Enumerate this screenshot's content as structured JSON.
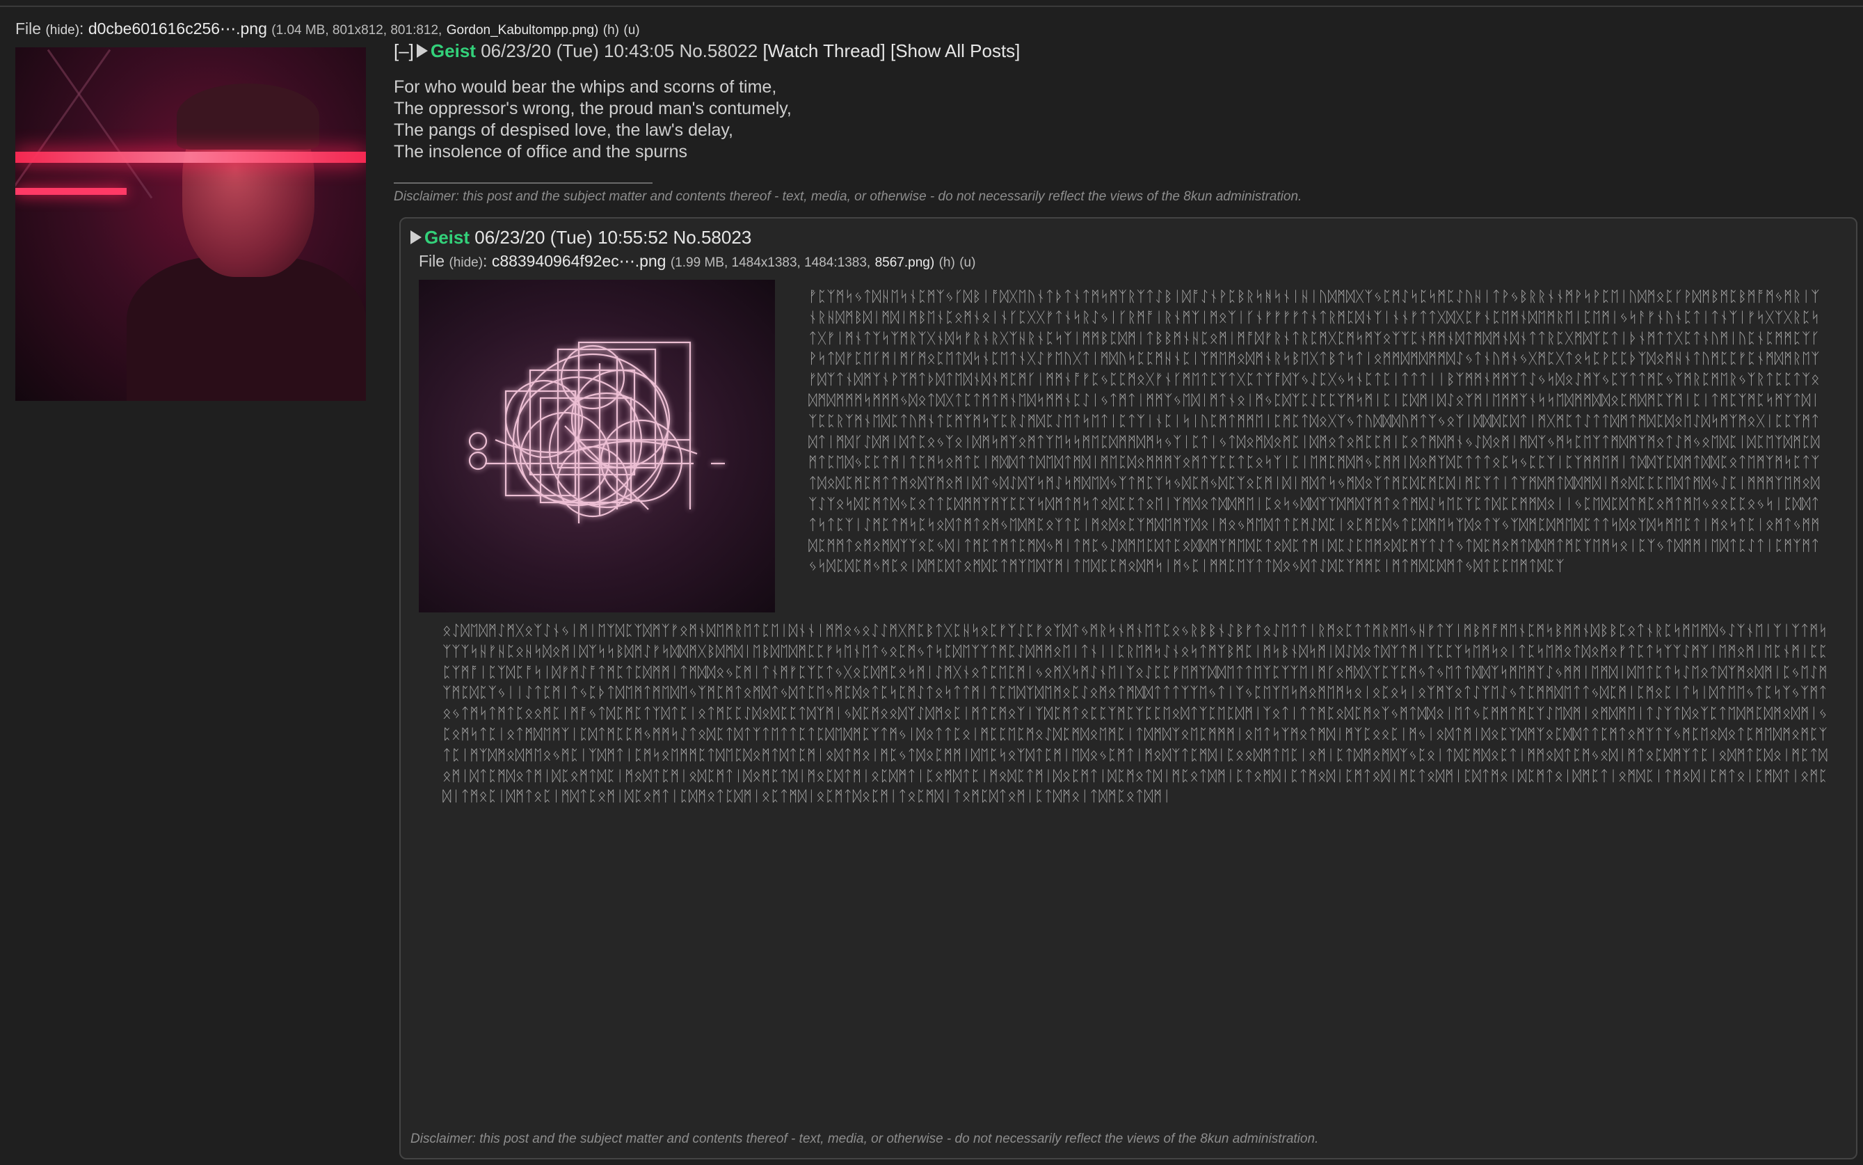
{
  "op": {
    "file": {
      "label": "File",
      "hide": "(hide)",
      "colon": ":",
      "filename": "d0cbe601616c256⋯.png",
      "info": "(1.04 MB, 801x812, 801:812,",
      "orig_name": "Gordon_Kabultompp.png)",
      "h": "(h)",
      "u": "(u)"
    },
    "header": {
      "collapse": "[–]",
      "name": "Geist",
      "datetime": "06/23/20 (Tue) 10:43:05",
      "number": "No.58022",
      "watch": "[Watch Thread]",
      "show_all": "[Show All Posts]"
    },
    "body": [
      "For who would bear the whips and scorns of time,",
      "The oppressor's wrong, the proud man's contumely,",
      "The pangs of despised love, the law's delay,",
      "The insolence of office and the spurns"
    ],
    "disclaimer": "Disclaimer: this post and the subject matter and contents thereof - text, media, or otherwise - do not necessarily reflect the views of the 8kun administration."
  },
  "reply": {
    "header": {
      "name": "Geist",
      "datetime": "06/23/20 (Tue) 10:55:52",
      "number": "No.58023"
    },
    "file": {
      "label": "File",
      "hide": "(hide)",
      "colon": ":",
      "filename": "c883940964f92ec⋯.png",
      "info": "(1.99 MB, 1484x1383, 1484:1383,",
      "size_png": "8567.png)",
      "h": "(h)",
      "u": "(u)"
    },
    "runes_top": "ᚡᛈᛉᛗᛋᛃᛏᛞᚺᛖᛋᚾᛈᛗᛉᛃᚴᛞᛒᛁᚩᛞᚷᛖᚢᚾᛏᚦᛏᚾᛏᛗᛋᛗᛉᚱᛉᛏᛇᛒᛁᛞᚩᛇᚾᚹᛈᛒᚱᛋᚻᛋᚾᛁᚺᛁᚢᛞᛗᛞᚷᛉᛃᛈᛗᛇᛋᛈᛋᛗᛈᛇᚢᚺᛁᛏᚹᛃᛒᚱᚱᚾᚾᛗᚹᛋᚹᛈᛖᛁᚢᛞᛗᛟᛈᚴᚹᛞᛗᛒᛗᛈᛒᛗᚩᛗᛃᛗᚱᛁᛉᚾᚱᚺᛞᛗᛒᛞᛁᛗᛞᛁᛗᛒᛖᚾᛈᛟᛗᚾᛟᛁᚾᚴᛈᚷᚷᚠᛏᚾᛋᚱᛇᛃᛁᚴᚱᛗᚩᛁᚱᚾᛗᛉᛁᛗᛟᛉᛁᚴᚾᚠᚠᚠᚠᛏᚾᛏᚱᛗᛈᛞᚾᛉᛁᚾᚾᚠᛏᛏᚷᛞᚷᛈᚠᚾᛈᛖᛗᚾᛞᛖᛗᚱᛖᛁᛈᛖᛗᛁᛃᛋᚨᚠᚾᚢᚾᛈᛏᛁᛏᚾᛉᛁᚠᛋᚷᛉᚷᚱᛈᛋᛏᚷᚠᛁᛗᚾᛏᛉᛋᛉᛗᚱᛉᚷᚾᛞᛋᚠᚱᚾᚱᚷᛉᚺᚱᚾᛈᛋᛉᛁᛗᛗᛒᛈᛞᛗᛁᛏᛒᛒᛗᚾᚺᛈᛟᛗᛁᛗᚩᛞᚠᚱᚾᛏᚱᛈᛗᚷᛈᛗᛋᛗᛉᛟᛉᛉᛈᚾᛗᛗᚾᛞᛏᛗᛞᛗᚾᛞᚾᛏᛏᚱᛈᚷᛗᛞᛉᛈᛏᛁᚦᚾᛗᛏᛏᚷᛈᛏᚾᚢᛗᛁᚢᛈᚾᛈᛗᛗᛈᛉᚴᚹᛋᛏᛞᚠᛈᛖᚴᛗᛁᛗᚴᛗᛟᛈᛖᛏᛞᛋᚾᛈᛖᛏᚾᚷᛇᚠᛖᚢᚷᛏᛁᛗᛞᚢᛋᛈᛈᛗᚺᚾᛈᛁᛉᛗᛖᛗᛟᛞᛗᚾᚱᛋᛒᛖᚷᛏᛒᛏᛋᛏᛁᛟᛗᛗᛞᛗᛞᛗᛗᛞᛇᛃᛏᚾᚢᛗᚾᛃᚷᛗᛈᚷᛏᛟᛋᛈᚹᛈᛈᚦᛉᛞᛟᛗᚺᚾᛏᚢᛗᛈᛈᚠᛈᚾᛗᛞᛗᚱᛖᛉᚠᛞᛉᛏᚾᛞᛗᛉᚾᚹᛉᛗᛏᚦᛞᛏᛖᛞᚾᛞᚾᛗᛈᛗᚴᛁᛗᛗᚾᚩᚠᛈᛃᛈᛈᛗᛟᚷᚠᚾᚴᛗᛖᛏᛈᛉᛏᚷᛈᛏᛉᚩᛞᛉᛃᛇᛈᚷᛃᛋᚾᛈᛏᛈᛁᛏᛏᛏᛁᛁᛒᛉᛗᛗᚾᛗᛗᛉᛏᛇᛃᛋᛞᛟᛇᛗᛉᛃᛈᛉᛏᛏᛗᛈᛃᛉᛗᚱᛈᛗᛖᚱᛃᛉᚱᛏᛈᛈᛏᛉᛟᛞᛗᛞᛗᛗᛗᛋᛗᛗᛗᛃᛞᛟᛏᛞᚷᛏᛈᛏᛗᛏᛗᚾᛖᛞᛋᛗᛗᚾᛈᛇᛁᛃᛏᛗᛏᛁᛗᛗᛉᛃᛖᛞᛁᛗᛏᚾᛟᛁᛗᛃᛈᛞᛉᛈᛇᛈᛈᛉᛗᛋᛗᛁᛈᛁᛈᛞᛗᛁᛞᛇᛟᛉᛗᛁᛖᛗᛗᛉᚾᛋᛋᛖᛞᛗᛗᛞᛞᛟᛈᛗᛞᛗᛈᛉᛗᛁᛈᛁᛏᛗᛈᛉᛗᛈᛋᛗᛉᛏᛞᛁᛉᛈᛈᚱᛉᛗᚾᛖᛞᛈᛏᚢᛗᚾᛏᛈᛗᛉᛗᛋᛉᛈᚱᛇᛗᛞᛈᛇᛖᛏᛋᛖᛏᛁᛈᛏᛉᛁᚾᛈᛁᛋᛁᚢᛈᛗᛏᛗᛗᛖᛁᛈᛗᛈᛏᛞᛟᚷᛉᛃᛏᚢᛞᛞᛞᚢᛗᛏᛉᛃᛟᛉᛁᛞᛞᛞᛈᛞᛏᛁᛗᚷᛗᛈᛏᛇᛏᛏᛞᛗᛏᛗᛞᛈᛞᛟᛖᛇᛞᛋᛗᛉᛗᛟᚷᛁᛈᛈᛉᛗᛏᛞᛏᛁᛗᛞᚴᛇᛞᛗᛁᛞᛏᛈᛟᛃᛉᛟᛁᛞᛗᛋᛗᛉᛟᛗᛏᛉᛖᛋᛋᛗᛖᛈᛞᛗᛗᛞᛗᛋᛃᛉᛁᛈᛏᛁᛃᛏᛞᛟᛗᛞᛟᛗᛈᛁᛞᛗᛟᛏᛟᛗᛈᛈᛗᛁᛈᛟᛏᛗᛞᛗᚾᛃᛇᛞᛟᛗᛁᛗᛞᛉᛃᛗᛋᛈᛖᛉᛏᛗᛞᛗᛉᛗᛟᛏᛇᛗᛃᛟᛖᛞᛈᛁᛞᛈᛖᛉᛞᛗᛈᛞᛗᛏᛈᛖᛞᛃᛈᛈᛏᛗᛁᛏᛈᛗᛋᛟᛗᛏᛈᛁᛗᛞᛞᛏᛏᛞᛖᛞᛏᛗᛞᛁᛗᛖᛈᛞᛟᛗᛗᛗᛉᛟᛗᛏᛉᛈᛈᛏᛈᛟᛋᛉᛁᛈᛁᛖᛗᛈᛗᛞᛗᛃᛈᛗᛗᛁᛞᛟᛗᛉᛞᛈᛏᛏᛏᛟᛈᛋᛃᛈᛈᛉᛁᛈᛉᛗᛗᛖᛗᛁᛏᛞᛞᛉᛈᛞᛗᛏᛞᛞᛈᛟᛏᛖᛗᛉᛗᛋᛈᛏᛉᛏᛞᛟᛞᛈᛗᛈᛗᛏᛏᛗᛟᛞᛉᛗᛟᛗᛁᛞᛏᛃᛞᛇᛞᛉᛋᛗᛇᛋᛗᛞᛖᛞᛃᛉᛏᛗᛈᛉᛋᛃᛞᛈᛗᛃᛞᛈᛉᛟᛈᛗᛁᛞᛁᛗᛞᛏᛋᛃᛗᛞᛟᛉᛏᛗᛈᛞᛈᛗᛈᛞᛁᛗᛈᛉᛏᛁᛏᛉᛗᛞᛗᛏᛞᛞᛗᛞᛁᛗᛟᛞᛈᛈᛈᛖᛞᛏᛗᛞᛃᛇᛈᛁᛗᛗᛗᛉᛖᛗᛟᛞᛉᛇᛉᛟᛋᛞᛈᛗᛏᛞᛃᛈᛟᛏᛏᛈᛞᛗᛗᛉᛗᛉᛈᛈᛉᛋᛞᛗᛏᛗᛋᛏᛟᛞᛈᛈᛏᛟᛖᛁᛉᛗᛞᛟᛏᛞᛞᛗᛖᛁᛈᛟᛋᛃᛞᛞᛉᛉᛞᛗᛞᛉᛗᛏᛟᛏᛗᛞᛇᛋᛖᛈᛉᛈᛏᛞᛈᛈᛗᛗᛞᛟᛁᛁᛃᛈᛖᛞᛈᛞᛏᛗᛈᛟᛗᛏᛗᛖᛃᛟᛟᛈᛈᛟᛃᛋᛁᛈᛞᛞᛏᛏᛋᛏᛈᛉᛁᛇᛗᛈᛏᛗᛋᛈᛋᛟᛞᛏᛗᛏᛟᛗᛃᛖᛞᛗᛈᛟᛉᛏᛈᛁᛗᛟᛞᛟᛈᛉᛗᛞᛖᛗᛉᛞᛟᛁᛗᛟᛃᛗᛖᛞᛏᛏᛈᛗᛇᛞᛈᛁᛟᛈᛗᛈᛞᛃᛏᛈᛞᛗᛖᛋᛉᛞᛟᛏᛉᛃᛉᛞᛗᛈᛞᛗᛖᛞᛈᛏᛏᛋᛞᛟᛉᛞᛋᛗᛖᛈᛏᛁᛗᛟᛋᛏᛈᛁᛟᛗᛏᛃᛗᛗᛞᛈᛗᛗᛏᛟᛗᛟᛗᛞᛉᛉᛟᛈᛃᛞᛁᛏᛗᛈᛏᛗᛏᛈᛗᛞᛃᛗᛁᛏᛗᛈᛃᛇᛞᛗᛖᛈᛞᛏᛈᛟᛞᛞᛗᛉᛗᛖᛞᛈᛏᛟᛞᛈᛏᛗᛁᛞᛈᛇᛈᛖᛗᛟᛞᛈᛗᛉᛏᛇᛏᛃᛏᛞᛈᛗᛟᛗᛏᛞᛞᛗᛏᛗᛈᛉᛖᛗᛋᛟᛁᛈᛉᛃᛏᛞᛗᛗᛁᛖᛞᛏᛈᛇᛏᛁᛈᛗᛉᛗᛏᛃᛋᛞᛈᛞᛈᛗᛃᛗᛈᛟᛁᛞᛗᛈᛞᛏᛟᛗᛞᛈᛏᛗᛉᛖᛞᛉᛗᛁᛏᛖᛞᛈᛈᛗᛟᛞᛗᛋᛁᛗᛃᛈᛁᛗᛗᛈᛖᛉᛏᛏᛞᛟᛃᛞᛏᛇᛞᛈᛉᛗᛗᛈᛁᛗᛏᛗᛞᛈᛞᛗᛏᛃᛞᛏᛈᛈᛖᛗᛏᛞᛈᛉ",
    "runes_bottom": "ᛟᛇᛞᛖᛞᛗᛇᛗᚷᛟᛉᛇᚾᛃᛁᛗᛁᛖᛉᛞᛈᛉᛞᛗᛉᚠᛟᛗᚾᛞᛖᛗᚱᛖᛏᛈᛖᛁᛞᚾᚾᛁᛗᛗᛟᛃᛟᛇᛇᛗᚷᛗᛈᛒᛏᚷᛈᚺᛋᛟᛈᚠᛉᛇᛈᚠᛟᛉᛞᛏᛃᛗᚱᛋᚾᛗᚾᛖᛏᛈᛟᛃᚱᛒᛒᚾᛇᛒᚠᛏᛟᛇᛖᛏᛏᛁᚱᛗᛟᛈᛏᛏᛗᚱᛗᛖᛃᚺᚠᛏᛉᛁᛗᛒᛗᚩᛗᛖᚾᛈᛗᛋᛒᛗᛗᚾᛞᛒᛒᛈᛟᛏᚾᚱᛈᛋᛗᛖᛗᛞᛃᛇᛉᚾᛖᛁᛉᛁᛉᛏᛗᛋᛉᛉᛉᛋᚺᚠᚺᛈᛟᚺᛋᛞᛟᛗᛁᛞᛉᛋᛋᛒᛞᛗᛇᚠᛋᛞᛞᛗᚷᛒᛞᛗᛞᛁᛖᛒᛞᛖᛞᛗᛈᛈᚠᛋᛖᚾᛖᛏᛃᛟᛈᛗᛃᛏᛋᛈᛞᛖᛉᛉᛏᛗᛈᛇᛞᛗᛗᛟᛖᛁᛏᚾᛁᛁᛈᚱᛖᛗᛋᛇᚾᛟᛋᛏᛗᛉᛒᛗᛈᛁᛗᛋᛒᚾᛞᛋᛗᛁᛞᛇᛞᛟᛏᛞᛉᛏᛗᛁᛉᛈᛈᛉᛋᛖᛗᛋᛟᛁᛏᛈᛋᛖᛗᛟᛏᛞᛟᛗᛟᚠᛏᛈᛏᛋᛉᛉᛇᛗᛉᛁᛖᛗᛟᛗᛁᛖᛈᚾᛗᛁᛈᛈᛈᛉᛗᚩᛁᛈᛉᛞᛈᚩᛋᛁᛞᚠᛗᛇᚩᛏᛗᛈᛏᛈᛞᛗᛗᛁᛏᛗᛞᛞᛟᛃᛈᛗᛁᛏᚾᛗᚠᛈᛉᛈᛏᛃᚷᛟᛈᛞᛗᛈᛟᛋᛗᛁᛇᛗᚷᚾᛟᛏᛈᛖᛈᛗᛁᛃᛟᛗᚷᛋᛗᛇᚾᛖᛁᛉᛟᛇᛈᛈᚠᛖᛗᛉᛞᛞᛖᛏᛏᛖᛉᛈᛉᛉᛖᛁᛗᚴᛟᛗᛞᚷᛉᛈᛉᛈᛗᛃᛏᛃᛖᛏᛏᛞᛞᛉᛋᛗᛖᛗᛉᛇᛃᛗᛗᛁᛖᛗᛞᛁᛞᛖᛏᛈᛏᛋᛇᛖᛟᛏᛞᛉᛗᛟᛞᛗᛁᛈᛃᛖᛇᛗᛉᛗᛈᛞᛈᛉᛃᛁᛁᛇᛏᛈᛗᛁᛏᛃᛈᚦᛏᛞᛖᛗᛏᛗᛖᛞᛖᛃᛉᛗᛈᛗᛏᛟᛗᛞᛏᛃᛞᛏᛈᛖᛃᛗᛈᛞᛟᛏᛈᛋᛈᛗᛇᛏᛟᛋᛏᛏᛗᛁᛏᛈᛖᛞᛉᛞᛖᛗᛟᛈᛇᛟᛗᛟᛏᛗᛞᛞᛏᛏᛏᛉᛉᛖᛃᛏᛁᛉᛃᛈᛖᛉᛖᛋᛗᛟᛗᛖᛗᛋᛟᛁᛟᛈᛟᛋᛁᛟᛉᛗᛉᛟᛏᛇᛉᛖᛇᛃᛏᛈᛗᛗᛞᛖᛏᛏᛃᛞᛈᛗᛁᛈᛗᛟᛈᛁᛏᛋᛁᛞᛏᛖᛖᛃᛏᛈᛋᛉᛃᛉᛗᛏᛟᛃᛏᛗᛋᛏᛗᛏᛈᛟᛟᛗᛈᛁᛗᚩᛃᛏᛞᛈᛗᛈᛏᛉᛞᛏᛈᛁᛟᛏᛗᛈᛈᛇᛞᛟᛞᛈᛈᛏᛞᛉᛗᛁᛃᛞᛈᛗᛟᛟᛞᛉᛇᛞᛗᛟᛈᛁᛗᛏᛈᛗᛟᛉᛁᛉᛞᛈᛗᛏᛟᛈᛈᛉᛗᛈᛉᛈᛈᛖᛟᛞᛏᛉᛈᛖᛈᛞᛗᛁᛉᛟᛏᛁᛏᛏᛗᛈᛟᛞᛈᛗᛟᛉᛃᛗᛏᛞᛞᛟᛁᛖᛏᛃᛈᛗᛗᛏᛗᛈᛉᛇᛖᛞᛗᛁᛟᛗᛞᛗᛖᛁᛏᛇᛉᛏᛞᛟᛉᛈᛏᛖᛞᛗᛈᛞᛗᛟᛞᛗᛁᛃᛈᛟᛗᛋᛏᛈᛁᛟᛏᛗᛞᛖᛗᛉᛁᛈᛞᛏᛗᛈᛈᛗᛃᛗᛗᛋᛇᛏᛟᛞᛈᛏᛞᛏᛉᛏᛖᛏᛏᛈᛏᛈᛞᛖᛞᛗᛈᛉᛏᛗᛃᛁᛞᛟᛏᛏᛈᛟᛁᛗᛈᛈᛖᛈᛗᛟᛇᛞᛈᛗᛞᛟᛖᛗᛈᛁᛏᛞᛗᛞᛉᛟᛖᛈᛗᛗᛗᛁᛟᛖᛏᛋᛉᛗᛟᛏᛗᛞᛁᛗᛉᛈᛟᛟᛈᛁᛗᛃᛁᛟᛞᛏᛗᛁᛞᛟᛈᛉᛞᛗᛉᛟᛈᛞᛞᛏᛏᛈᛗᛏᛟᛗᛉᛏᛉᛃᛗᛈᛖᛟᛞᛟᛏᛈᛗᛖᛞᛗᛟᛗᛈᛉᛏᛈᛁᛗᛉᛞᛗᛟᛞᛗᛖᛟᛃᛗᛈᛁᛉᛞᛗᛏᛁᛈᛗᛋᛟᛖᛗᛗᛈᛏᛞᛖᛈᛞᛟᛗᛏᛞᛏᛈᛗᛁᛟᛞᛏᛗᛟᛁᛗᛈᛃᛏᛞᛟᛈᛗᛗᛁᛞᛖᛈᛋᛟᛉᛞᛏᛈᛗᛁᛖᛞᛟᛃᛈᛗᛏᛁᛗᛟᛞᛉᛏᛈᛗᛞᛁᛈᛟᛟᛞᛗᛏᛖᛈᛁᛟᛗᛁᛈᛏᛞᛗᛟᛗᛞᛉᛃᛈᛟᛁᛏᛞᛈᛗᛞᛟᛈᛏᛁᛗᛗᛟᛞᛏᛈᛗᛃᛟᛞᛁᛗᛏᛟᛈᛞᛗᛉᛏᛈᛁᛟᛞᛗᛏᛈᛞᛟᛁᛗᛈᛏᛞᛟᛗᛁᛞᛏᛈᛗᛞᛟᛏᛗᛁᛞᛈᛟᛗᛏᛞᛈᛁᛗᛟᛞᛏᛈᛗᛁᛟᛞᛈᛗᛏᛁᛞᛟᛗᛈᛏᛞᛁᛗᛟᛈᛞᛏᛗᛁᛟᛈᛞᛗᛏᛁᛈᛟᛗᛞᛏᛈᛁᛗᛟᛞᛈᛏᛗᛁᛞᛟᛈᛗᛏᛁᛞᛈᛗᛟᛏᛞᛁᛗᛈᛟᛏᛞᛗᛁᛈᛏᛟᛗᛞᛁᛈᛏᛗᛟᛞᛁᛈᛗᛏᛟᛞᛁᛗᛈᛏᛟᛞᛗᛁᛈᛞᛏᛗᛟᛁᛞᛈᛗᛏᛟᛁᛞᛗᛈᛏᛁᛟᛗᛞᛈᛁᛏᛗᛟᛞᛁᛈᛗᛏᛟᛁᛈᛗᛞᛏᛁᛟᛗᛈᛞᛁᛏᛗᛟᛈᛁᛞᛗᛏᛟᛈᛁᛗᛞᛏᛈᛟᛗᛁᛞᛈᛟᛗᛏᛁᛈᛞᛗᛟᛏᛈᛞᛗᛁᛟᛈᛏᛗᛞᛁᛟᛈᛗᛏᛞᛟᛈᛗᛁᛏᛟᛈᛗᛞᛁᛏᛟᛗᛈᛞᛏᛟᛗᛁᛈᛏᛞᛗᛟᛁᛏᛞᛗᛈᛟᛏᛞᛗᛁ",
    "disclaimer": "Disclaimer: this post and the subject matter and contents thereof - text, media, or otherwise - do not necessarily reflect the views of the 8kun administration."
  },
  "colors": {
    "name": "#33d17a",
    "background": "#1f1f1f",
    "reply_bg": "#262626",
    "neon": "#ff2a55"
  }
}
